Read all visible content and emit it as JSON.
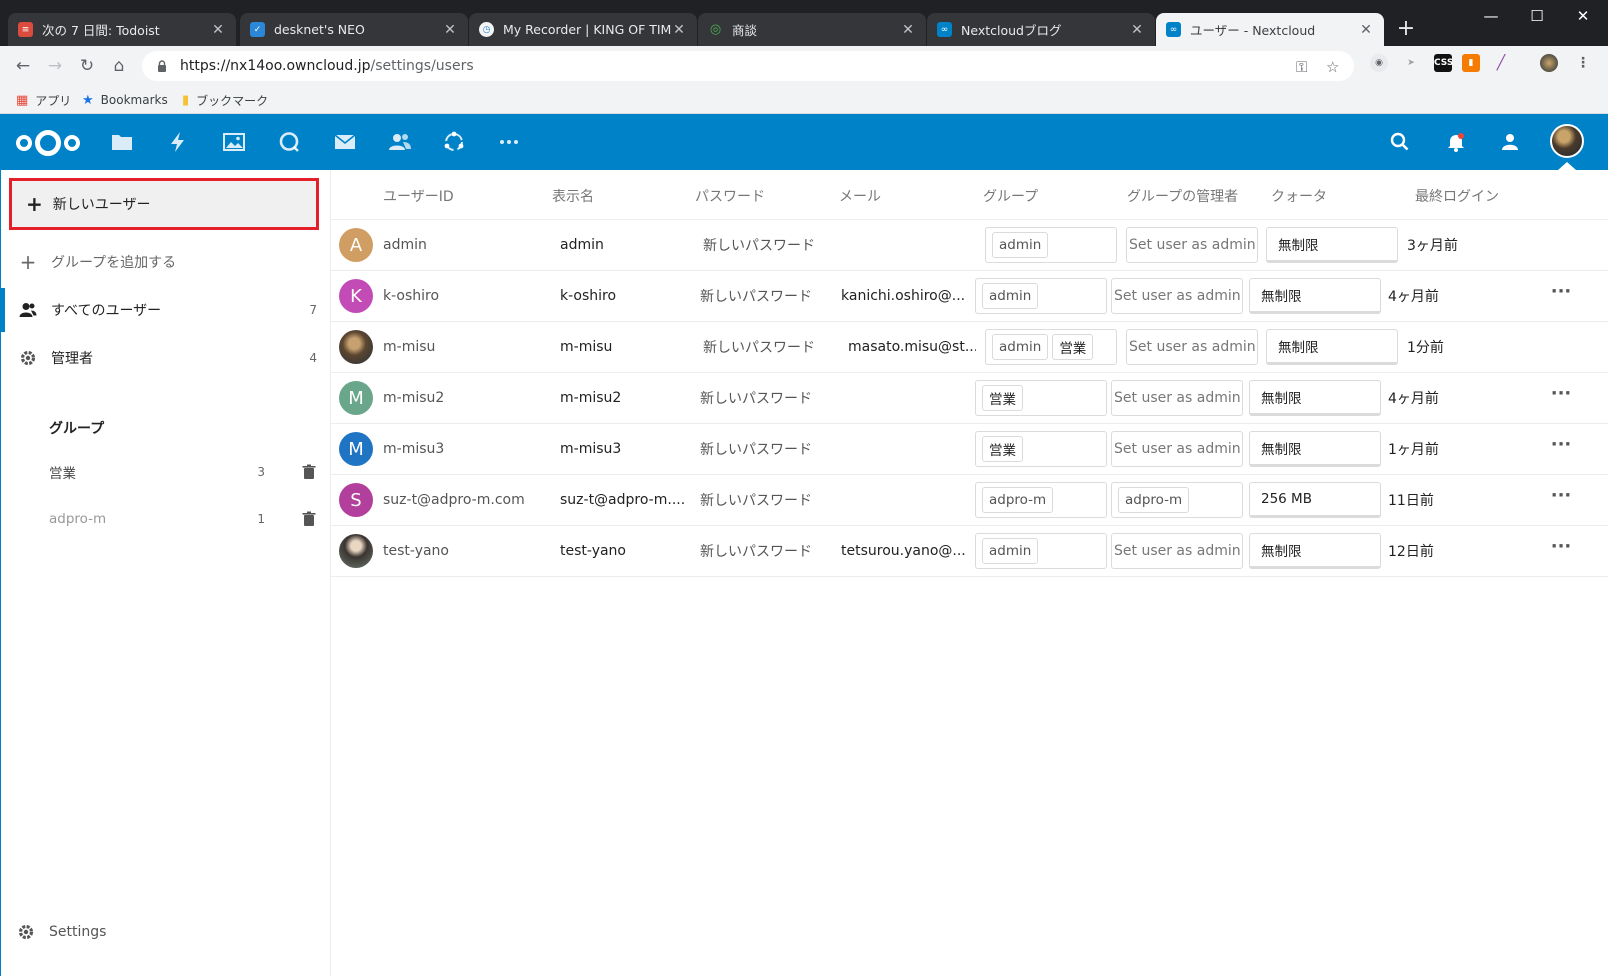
{
  "browser": {
    "tabs": [
      {
        "title": "次の 7 日間: Todoist",
        "favicon_color": "#db4c3f"
      },
      {
        "title": "desknet's NEO",
        "favicon_color": "#2b88d8"
      },
      {
        "title": "My Recorder | KING OF TIME",
        "favicon_color": "#35363a"
      },
      {
        "title": "商談",
        "favicon_color": "#35363a"
      },
      {
        "title": "Nextcloudブログ",
        "favicon_color": "#0082c9"
      },
      {
        "title": "ユーザー - Nextcloud",
        "favicon_color": "#0082c9"
      }
    ],
    "url_host": "https://nx14oo.owncloud.jp",
    "url_path": "/settings/users",
    "bookmarks": [
      "アプリ",
      "Bookmarks",
      "ブックマーク"
    ]
  },
  "sidebar": {
    "new_user_label": "新しいユーザー",
    "add_group_label": "グループを追加する",
    "all_users_label": "すべてのユーザー",
    "all_users_count": "7",
    "admins_label": "管理者",
    "admins_count": "4",
    "groups_caption": "グループ",
    "groups": [
      {
        "name": "営業",
        "count": "3"
      },
      {
        "name": "adpro-m",
        "count": "1"
      }
    ],
    "settings_label": "Settings"
  },
  "table": {
    "headers": [
      "ユーザーID",
      "表示名",
      "パスワード",
      "メール",
      "グループ",
      "グループの管理者",
      "クォータ",
      "最終ログイン"
    ],
    "rows": [
      {
        "avatar": "A",
        "avatar_color": "#d09d63",
        "id": "admin",
        "display": "admin",
        "password": "新しいパスワード",
        "email": "",
        "groups": [
          "admin"
        ],
        "subadmin": "Set user as admin for",
        "quota": "無制限",
        "last_login": "3ヶ月前",
        "has_menu": false
      },
      {
        "avatar": "K",
        "avatar_color": "#c34bb5",
        "id": "k-oshiro",
        "display": "k-oshiro",
        "password": "新しいパスワード",
        "email": "kanichi.oshiro@...",
        "groups": [
          "admin"
        ],
        "subadmin": "Set user as admin for",
        "quota": "無制限",
        "last_login": "4ヶ月前",
        "has_menu": true
      },
      {
        "avatar": "",
        "avatar_color": "",
        "id": "m-misu",
        "display": "m-misu",
        "password": "新しいパスワード",
        "email": "masato.misu@st...",
        "groups": [
          "admin",
          "営業"
        ],
        "subadmin": "Set user as admin for",
        "quota": "無制限",
        "last_login": "1分前",
        "has_menu": false
      },
      {
        "avatar": "M",
        "avatar_color": "#6aa68a",
        "id": "m-misu2",
        "display": "m-misu2",
        "password": "新しいパスワード",
        "email": "",
        "groups": [
          "営業"
        ],
        "subadmin": "Set user as admin for",
        "quota": "無制限",
        "last_login": "4ヶ月前",
        "has_menu": true
      },
      {
        "avatar": "M",
        "avatar_color": "#1f75c4",
        "id": "m-misu3",
        "display": "m-misu3",
        "password": "新しいパスワード",
        "email": "",
        "groups": [
          "営業"
        ],
        "subadmin": "Set user as admin for",
        "quota": "無制限",
        "last_login": "1ヶ月前",
        "has_menu": true
      },
      {
        "avatar": "S",
        "avatar_color": "#b23f9c",
        "id": "suz-t@adpro-m.com",
        "display": "suz-t@adpro-m....",
        "password": "新しいパスワード",
        "email": "",
        "groups": [
          "adpro-m"
        ],
        "subadmin": "adpro-m",
        "quota": "256 MB",
        "last_login": "11日前",
        "has_menu": true
      },
      {
        "avatar": "",
        "avatar_color": "",
        "id": "test-yano",
        "display": "test-yano",
        "password": "新しいパスワード",
        "email": "tetsurou.yano@...",
        "groups": [
          "admin"
        ],
        "subadmin": "Set user as admin for",
        "quota": "無制限",
        "last_login": "12日前",
        "has_menu": true
      }
    ]
  },
  "colors": {
    "brand": "#0082c9",
    "highlight": "#e3202a"
  }
}
